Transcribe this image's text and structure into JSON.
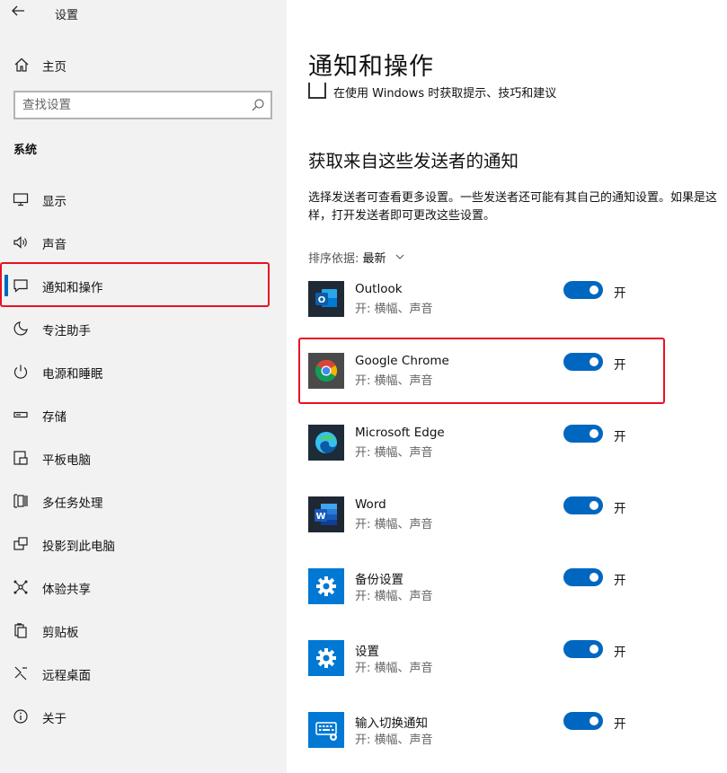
{
  "window": {
    "title": "设置",
    "back_icon": "back-arrow-icon"
  },
  "sidebar": {
    "home_label": "主页",
    "search_placeholder": "查找设置",
    "section_label": "系统",
    "items": [
      {
        "label": "显示",
        "icon": "monitor-icon"
      },
      {
        "label": "声音",
        "icon": "speaker-icon"
      },
      {
        "label": "通知和操作",
        "icon": "notification-icon",
        "selected": true
      },
      {
        "label": "专注助手",
        "icon": "moon-icon"
      },
      {
        "label": "电源和睡眠",
        "icon": "power-icon"
      },
      {
        "label": "存储",
        "icon": "storage-icon"
      },
      {
        "label": "平板电脑",
        "icon": "tablet-icon"
      },
      {
        "label": "多任务处理",
        "icon": "multitask-icon"
      },
      {
        "label": "投影到此电脑",
        "icon": "project-icon"
      },
      {
        "label": "体验共享",
        "icon": "share-icon"
      },
      {
        "label": "剪贴板",
        "icon": "clipboard-icon"
      },
      {
        "label": "远程桌面",
        "icon": "remote-icon"
      },
      {
        "label": "关于",
        "icon": "info-icon"
      }
    ]
  },
  "main": {
    "title": "通知和操作",
    "tips_checkbox_label": "在使用 Windows 时获取提示、技巧和建议",
    "tips_checked": false,
    "senders_title": "获取来自这些发送者的通知",
    "senders_desc": "选择发送者可查看更多设置。一些发送者还可能有其自己的通知设置。如果是这样，打开发送者即可更改这些设置。",
    "sort_label": "排序依据:",
    "sort_value": "最新",
    "apps": [
      {
        "name": "Outlook",
        "sub": "开: 横幅、声音",
        "state": "开",
        "on": true,
        "icon": "outlook-icon"
      },
      {
        "name": "Google Chrome",
        "sub": "开: 横幅、声音",
        "state": "开",
        "on": true,
        "icon": "chrome-icon"
      },
      {
        "name": "Microsoft Edge",
        "sub": "开: 横幅、声音",
        "state": "开",
        "on": true,
        "icon": "edge-icon"
      },
      {
        "name": "Word",
        "sub": "开: 横幅、声音",
        "state": "开",
        "on": true,
        "icon": "word-icon"
      },
      {
        "name": "备份设置",
        "sub": "开: 横幅、声音",
        "state": "开",
        "on": true,
        "icon": "gear-icon"
      },
      {
        "name": "设置",
        "sub": "开: 横幅、声音",
        "state": "开",
        "on": true,
        "icon": "gear-icon"
      },
      {
        "name": "输入切换通知",
        "sub": "开: 横幅、声音",
        "state": "开",
        "on": true,
        "icon": "keyboard-icon"
      }
    ]
  },
  "colors": {
    "accent": "#0067c0",
    "highlight": "#e81123",
    "sidebar_bg": "#f2f2f2"
  }
}
